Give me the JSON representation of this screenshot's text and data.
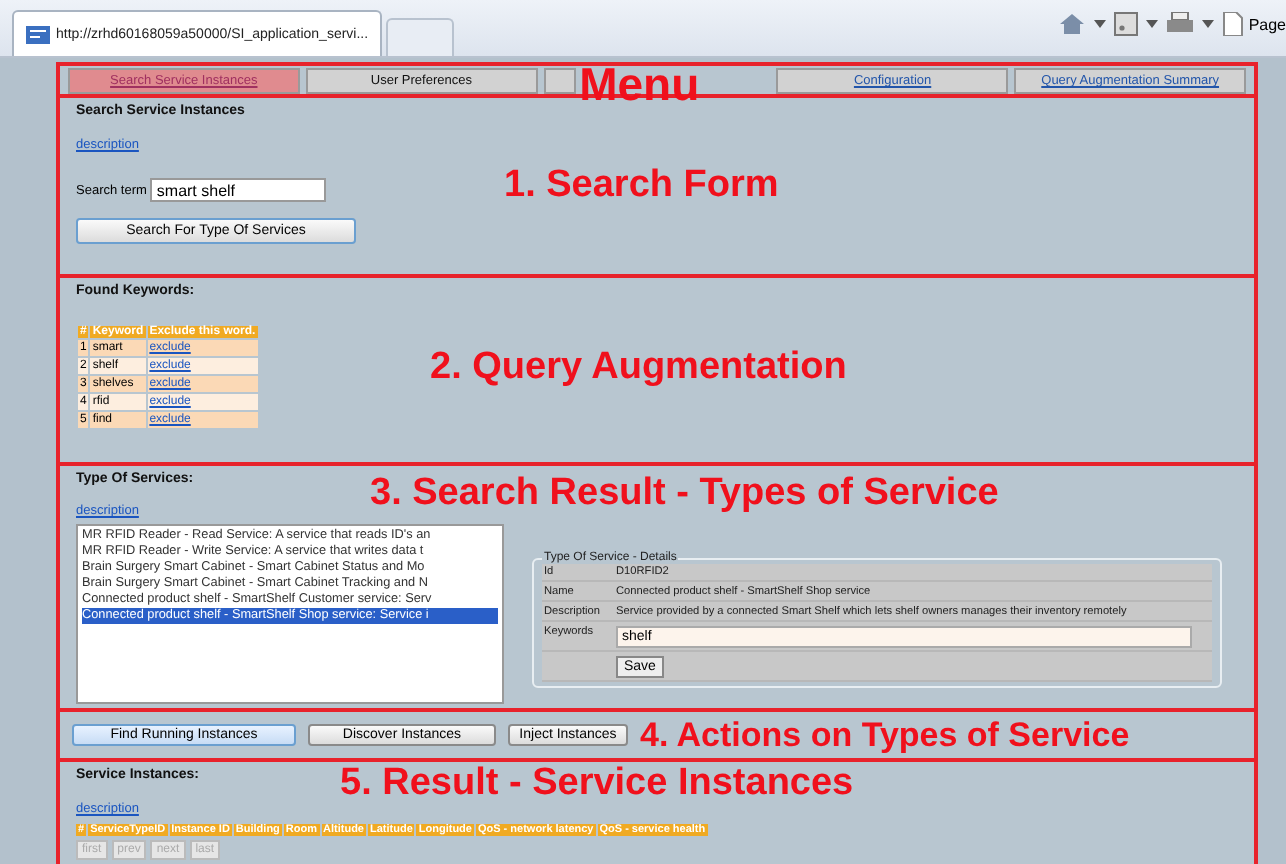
{
  "browser": {
    "tab_title": "http://zrhd60168059a50000/SI_application_servi...",
    "toolbar_label": "Page"
  },
  "menu": {
    "annotation": "Menu",
    "tabs": [
      {
        "label": "Search Service Instances",
        "selected": true
      },
      {
        "label": "User Preferences",
        "selected": false
      },
      {
        "selected": false
      },
      {
        "label": "Configuration",
        "selected": false
      },
      {
        "label": "Query Augmentation Summary",
        "selected": false
      }
    ]
  },
  "search_form": {
    "annotation": "1. Search Form",
    "title": "Search Service Instances",
    "description_link": "description",
    "search_label": "Search term",
    "search_value": "smart shelf",
    "button": "Search For Type Of Services"
  },
  "query_augmentation": {
    "annotation": "2. Query Augmentation",
    "title": "Found Keywords:",
    "columns": [
      "#",
      "Keyword",
      "Exclude this word."
    ],
    "rows": [
      {
        "index": "1",
        "keyword": "smart",
        "action": "exclude"
      },
      {
        "index": "2",
        "keyword": "shelf",
        "action": "exclude"
      },
      {
        "index": "3",
        "keyword": "shelves",
        "action": "exclude"
      },
      {
        "index": "4",
        "keyword": "rfid",
        "action": "exclude"
      },
      {
        "index": "5",
        "keyword": "find",
        "action": "exclude"
      }
    ]
  },
  "types_of_service": {
    "annotation": "3. Search Result - Types of Service",
    "title": "Type Of Services:",
    "description_link": "description",
    "items": [
      {
        "label": "MR RFID Reader - Read Service: A service that reads ID's an",
        "selected": false
      },
      {
        "label": "MR RFID Reader - Write Service: A service that writes data t",
        "selected": false
      },
      {
        "label": "Brain Surgery Smart Cabinet - Smart Cabinet Status and Mo",
        "selected": false
      },
      {
        "label": "Brain Surgery Smart Cabinet - Smart Cabinet Tracking and N",
        "selected": false
      },
      {
        "label": "Connected product shelf - SmartShelf Customer service: Serv",
        "selected": false
      },
      {
        "label": "Connected product shelf - SmartShelf Shop service: Service i",
        "selected": true
      }
    ],
    "details": {
      "legend": "Type Of Service - Details",
      "fields": [
        {
          "label": "Id",
          "value": "D10RFID2"
        },
        {
          "label": "Name",
          "value": "Connected product shelf - SmartShelf Shop service"
        },
        {
          "label": "Description",
          "value": "Service provided by a connected Smart Shelf which lets shelf owners manages their inventory remotely"
        }
      ],
      "keywords_label": "Keywords",
      "keywords_value": "shelf",
      "save_button": "Save"
    }
  },
  "actions": {
    "annotation": "4. Actions on Types of Service",
    "buttons": [
      {
        "label": "Find Running Instances",
        "selected": true
      },
      {
        "label": "Discover Instances",
        "selected": false
      },
      {
        "label": "Inject Instances",
        "selected": false
      }
    ]
  },
  "service_instances": {
    "annotation": "5. Result - Service Instances",
    "title": "Service Instances:",
    "description_link": "description",
    "columns": [
      "#",
      "ServiceTypeID",
      "Instance ID",
      "Building",
      "Room",
      "Altitude",
      "Latitude",
      "Longitude",
      "QoS - network latency",
      "QoS - service health"
    ],
    "pager": [
      {
        "label": "first",
        "disabled": true
      },
      {
        "label": "prev",
        "disabled": true
      },
      {
        "label": "next",
        "disabled": true
      },
      {
        "label": "last",
        "disabled": true
      }
    ]
  }
}
